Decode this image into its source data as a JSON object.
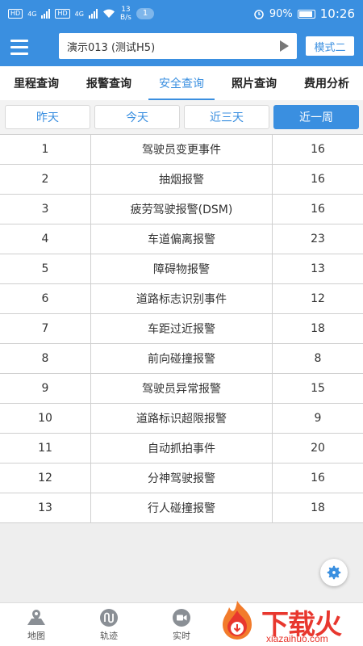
{
  "status_bar": {
    "hd1": "HD",
    "net_4g_1": "4G",
    "hd2": "HD",
    "net_4g_2": "4G",
    "speed_value": "13",
    "speed_unit": "B/s",
    "notification_count": "1",
    "battery": "90%",
    "time": "10:26"
  },
  "header": {
    "vehicle": "演示013 (测试H5)",
    "mode_button": "模式二"
  },
  "tabs": [
    {
      "label": "里程查询"
    },
    {
      "label": "报警查询"
    },
    {
      "label": "安全查询"
    },
    {
      "label": "照片查询"
    },
    {
      "label": "费用分析"
    }
  ],
  "active_tab": "安全查询",
  "ranges": [
    {
      "label": "昨天"
    },
    {
      "label": "今天"
    },
    {
      "label": "近三天"
    },
    {
      "label": "近一周"
    }
  ],
  "active_range": "近一周",
  "table": {
    "rows": [
      {
        "idx": "1",
        "name": "驾驶员变更事件",
        "count": "16"
      },
      {
        "idx": "2",
        "name": "抽烟报警",
        "count": "16"
      },
      {
        "idx": "3",
        "name": "疲劳驾驶报警(DSM)",
        "count": "16"
      },
      {
        "idx": "4",
        "name": "车道偏离报警",
        "count": "23"
      },
      {
        "idx": "5",
        "name": "障碍物报警",
        "count": "13"
      },
      {
        "idx": "6",
        "name": "道路标志识别事件",
        "count": "12"
      },
      {
        "idx": "7",
        "name": "车距过近报警",
        "count": "18"
      },
      {
        "idx": "8",
        "name": "前向碰撞报警",
        "count": "8"
      },
      {
        "idx": "9",
        "name": "驾驶员异常报警",
        "count": "15"
      },
      {
        "idx": "10",
        "name": "道路标识超限报警",
        "count": "9"
      },
      {
        "idx": "11",
        "name": "自动抓拍事件",
        "count": "20"
      },
      {
        "idx": "12",
        "name": "分神驾驶报警",
        "count": "16"
      },
      {
        "idx": "13",
        "name": "行人碰撞报警",
        "count": "18"
      }
    ]
  },
  "bottom_nav": [
    {
      "label": "地图",
      "icon": "map-icon"
    },
    {
      "label": "轨迹",
      "icon": "track-icon"
    },
    {
      "label": "实时",
      "icon": "video-icon"
    }
  ],
  "watermark": {
    "brand": "下载火",
    "url": "xiazaihuo.com"
  },
  "colors": {
    "primary": "#3a8fe0",
    "watermark_red": "#e8372e"
  }
}
